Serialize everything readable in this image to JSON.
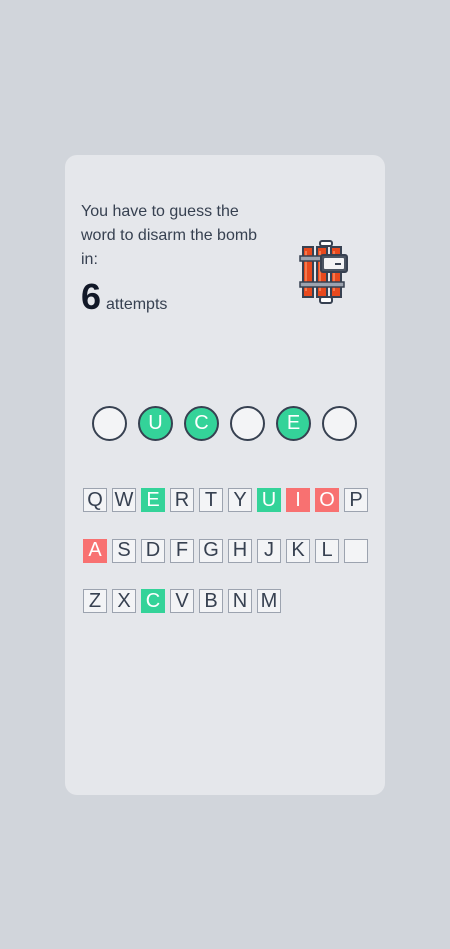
{
  "intro": {
    "text": "You have to guess the word to disarm the bomb in:",
    "attempts_count": "6",
    "attempts_label": "attempts"
  },
  "icons": {
    "bomb": "dynamite-bomb-icon"
  },
  "colors": {
    "correct": "#34d399",
    "wrong": "#f87171",
    "slot_border": "#374151",
    "card": "#e5e7eb",
    "background": "#d1d5db"
  },
  "word_slots": [
    "",
    "U",
    "C",
    "",
    "E",
    ""
  ],
  "keyboard": {
    "rows": [
      [
        {
          "label": "Q",
          "state": "unused"
        },
        {
          "label": "W",
          "state": "unused"
        },
        {
          "label": "E",
          "state": "correct"
        },
        {
          "label": "R",
          "state": "unused"
        },
        {
          "label": "T",
          "state": "unused"
        },
        {
          "label": "Y",
          "state": "unused"
        },
        {
          "label": "U",
          "state": "correct"
        },
        {
          "label": "I",
          "state": "wrong"
        },
        {
          "label": "O",
          "state": "wrong"
        },
        {
          "label": "P",
          "state": "unused"
        }
      ],
      [
        {
          "label": "A",
          "state": "wrong"
        },
        {
          "label": "S",
          "state": "unused"
        },
        {
          "label": "D",
          "state": "unused"
        },
        {
          "label": "F",
          "state": "unused"
        },
        {
          "label": "G",
          "state": "unused"
        },
        {
          "label": "H",
          "state": "unused"
        },
        {
          "label": "J",
          "state": "unused"
        },
        {
          "label": "K",
          "state": "unused"
        },
        {
          "label": "L",
          "state": "unused"
        },
        {
          "label": "",
          "state": "unused"
        }
      ],
      [
        {
          "label": "Z",
          "state": "unused"
        },
        {
          "label": "X",
          "state": "unused"
        },
        {
          "label": "C",
          "state": "correct"
        },
        {
          "label": "V",
          "state": "unused"
        },
        {
          "label": "B",
          "state": "unused"
        },
        {
          "label": "N",
          "state": "unused"
        },
        {
          "label": "M",
          "state": "unused"
        }
      ]
    ]
  }
}
